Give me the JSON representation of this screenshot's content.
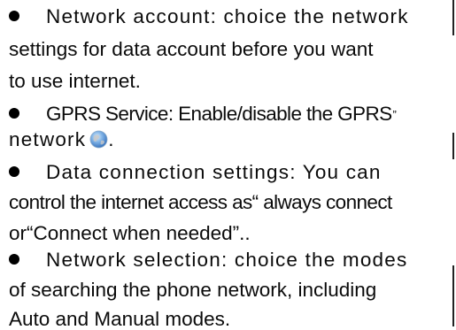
{
  "items": [
    {
      "lines": [
        "Network account: choice the network",
        "settings for data account before you want",
        "to use internet."
      ]
    },
    {
      "lines": [
        "GPRS Service: Enable/disable the GPRS",
        "network",
        "."
      ],
      "trailing_mark": "”"
    },
    {
      "lines": [
        "Data connection settings: You can",
        "control the internet access as“ always connect",
        "or“Connect when needed”.."
      ]
    },
    {
      "lines": [
        "Network selection: choice the modes",
        "of searching the phone network, including",
        "Auto and Manual modes."
      ]
    }
  ],
  "icons": {
    "network_icon": "globe-icon"
  },
  "colors": {
    "text": "#0b0b0b",
    "globe_blue": "#3f7fd0",
    "globe_light": "#9ec9f2",
    "globe_grey": "#c8c8c8"
  }
}
